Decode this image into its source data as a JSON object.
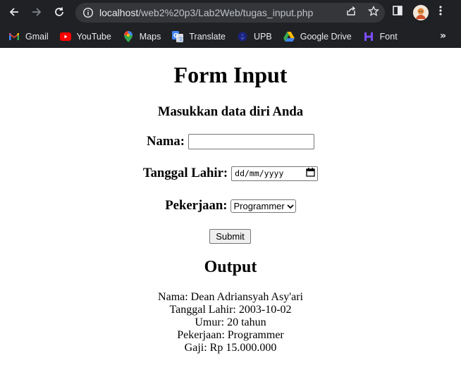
{
  "browser": {
    "url_host": "localhost",
    "url_path": "/web2%20p3/Lab2Web/tugas_input.php",
    "bookmarks": [
      {
        "label": "Gmail",
        "icon": "gmail-icon"
      },
      {
        "label": "YouTube",
        "icon": "youtube-icon"
      },
      {
        "label": "Maps",
        "icon": "maps-icon"
      },
      {
        "label": "Translate",
        "icon": "translate-icon"
      },
      {
        "label": "UPB",
        "icon": "upb-icon"
      },
      {
        "label": "Google Drive",
        "icon": "google-drive-icon"
      },
      {
        "label": "Font",
        "icon": "font-icon"
      }
    ],
    "more_label": "»"
  },
  "page": {
    "title": "Form Input",
    "subtitle": "Masukkan data diri Anda",
    "form": {
      "nama_label": "Nama:",
      "nama_value": "",
      "tanggal_label": "Tanggal Lahir:",
      "tanggal_placeholder": "dd/mm/yyyy",
      "pekerjaan_label": "Pekerjaan:",
      "pekerjaan_selected": "Programmer",
      "submit_label": "Submit"
    },
    "output": {
      "heading": "Output",
      "lines": [
        "Nama: Dean Adriansyah Asy'ari",
        "Tanggal Lahir: 2003-10-02",
        "Umur: 20 tahun",
        "Pekerjaan: Programmer",
        "Gaji: Rp 15.000.000"
      ]
    }
  }
}
